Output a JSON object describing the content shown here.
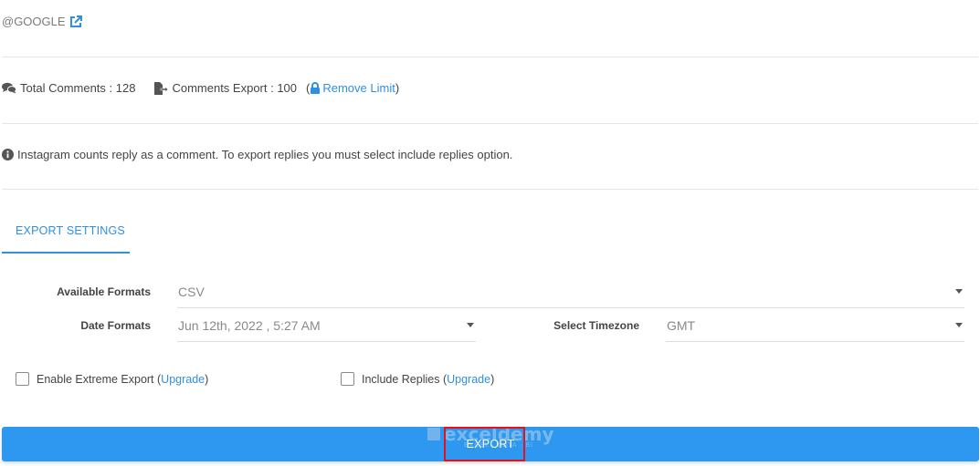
{
  "account": {
    "handle": "@GOOGLE",
    "icon": "external-link-icon"
  },
  "stats": {
    "total_comments": "Total Comments : 128",
    "comments_export": "Comments Export : 100",
    "paren_open": "(",
    "remove_limit": "Remove Limit",
    "paren_close": ")"
  },
  "info": {
    "text": "Instagram counts reply as a comment. To export replies you must select include replies option."
  },
  "tab": {
    "label": "EXPORT SETTINGS"
  },
  "settings": {
    "available_formats_label": "Available Formats",
    "available_formats_value": "CSV",
    "date_formats_label": "Date Formats",
    "date_formats_value": "Jun 12th, 2022 , 5:27 AM",
    "timezone_label": "Select Timezone",
    "timezone_value": "GMT"
  },
  "options": {
    "extreme_export_label": "Enable Extreme Export (",
    "extreme_upgrade": "Upgrade",
    "extreme_close": ")",
    "include_replies_label": "Include Replies (",
    "replies_upgrade": "Upgrade",
    "replies_close": ")"
  },
  "export_button": {
    "label": "EXPORT"
  },
  "watermark": {
    "name": "exceldemy",
    "sub": "EXCEL · DATA · BI"
  },
  "colors": {
    "accent": "#2f8fe0",
    "button": "#2e97ef",
    "highlight": "#e0141e"
  }
}
